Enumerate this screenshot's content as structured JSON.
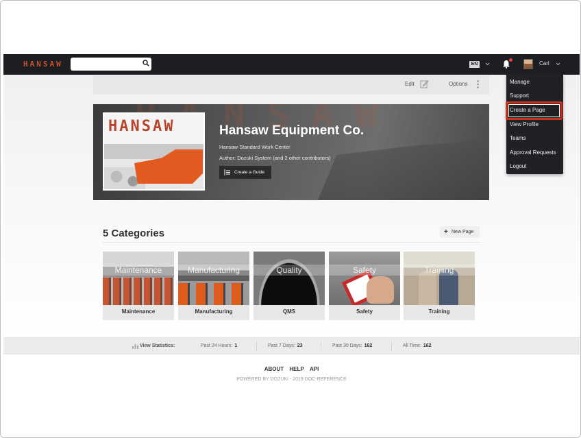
{
  "nav": {
    "logo": "HANSAW",
    "search_placeholder": "",
    "language": "EN",
    "user_name": "Carl"
  },
  "toolbar": {
    "edit_label": "Edit",
    "options_label": "Options"
  },
  "hero": {
    "logo_text": "HANSAW",
    "title": "Hansaw Equipment Co.",
    "subtitle": "Hansaw Standard Work Center",
    "author": "Author: Dozuki System (and 2 other contributors)",
    "create_guide_label": "Create a Guide"
  },
  "categories": {
    "heading": "5 Categories",
    "new_page_label": "New Page",
    "items": [
      {
        "overlay": "Maintenance",
        "label": "Maintenance"
      },
      {
        "overlay": "Manufacturing",
        "label": "Manufacturing"
      },
      {
        "overlay": "Quality",
        "label": "QMS"
      },
      {
        "overlay": "Safety",
        "label": "Safety"
      },
      {
        "overlay": "Training",
        "label": "Training"
      }
    ]
  },
  "stats": {
    "label": "View Statistics:",
    "past24_label": "Past 24 Hours:",
    "past24_value": "1",
    "past7_label": "Past 7 Days:",
    "past7_value": "23",
    "past30_label": "Past 30 Days:",
    "past30_value": "162",
    "alltime_label": "All Time:",
    "alltime_value": "162"
  },
  "footer": {
    "links": [
      "ABOUT",
      "HELP",
      "API"
    ],
    "powered": "POWERED BY DOZUKI - 2019 DOC-REFERENCE"
  },
  "user_menu": {
    "items": [
      "Manage",
      "Support",
      "Create a Page",
      "View Profile",
      "Teams",
      "Approval Requests",
      "Logout"
    ],
    "highlighted": "Create a Page"
  },
  "colors": {
    "nav_bg": "#1c1e22",
    "brand": "#c8532a",
    "highlight": "#c8331c",
    "notification": "#e7413f"
  }
}
